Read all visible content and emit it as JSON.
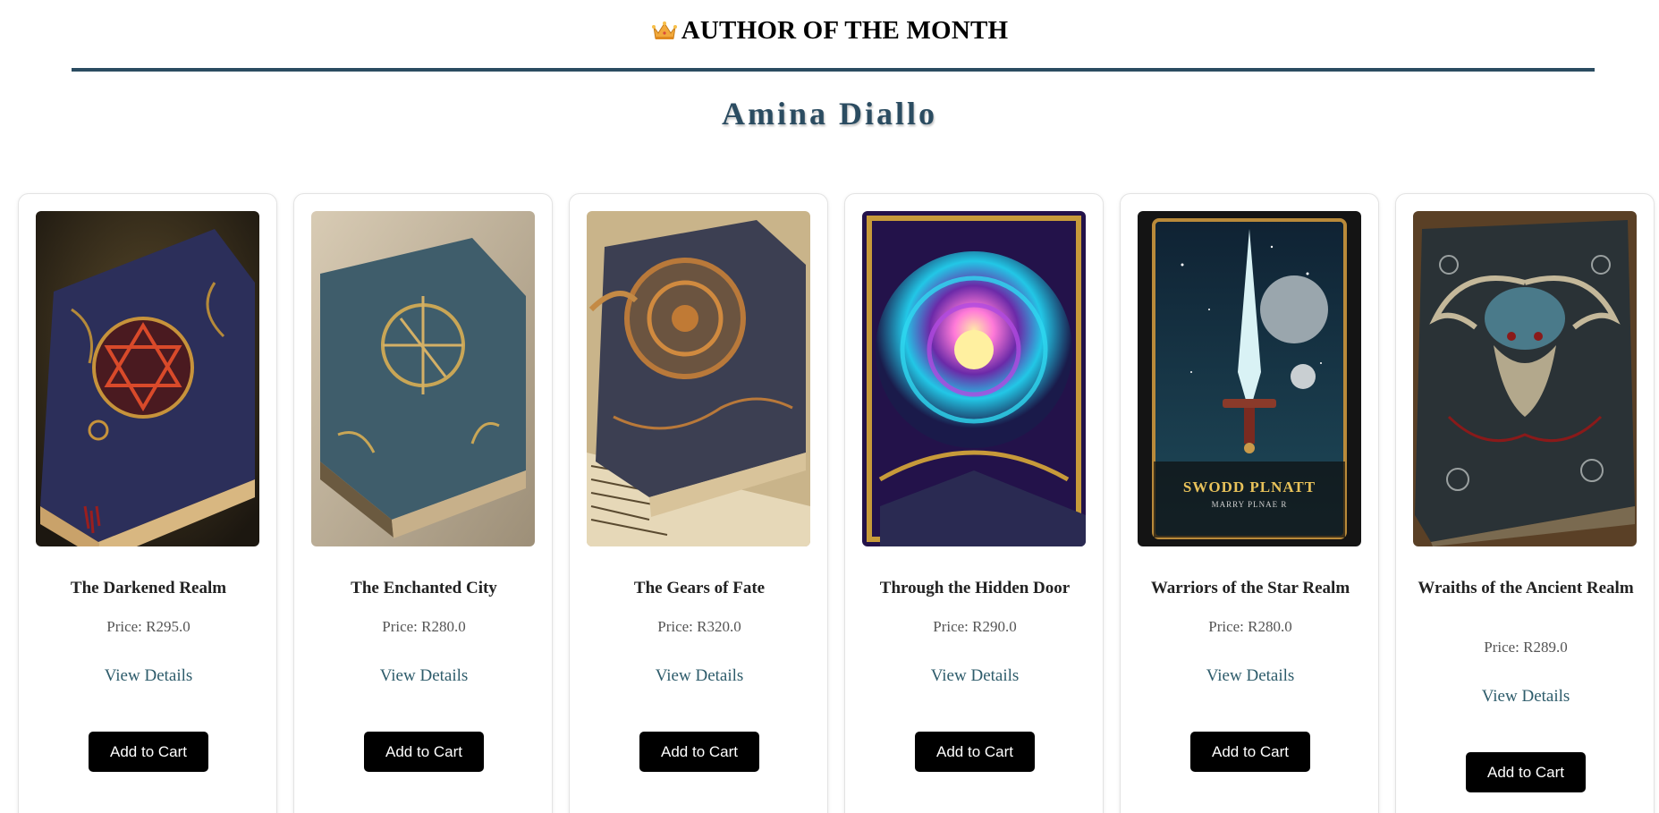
{
  "header": {
    "title": "AUTHOR OF THE MONTH",
    "icon": "crown-icon"
  },
  "author": {
    "name": "Amina Diallo"
  },
  "colors": {
    "accent": "#2b4c61",
    "link": "#2e5c6b",
    "button_bg": "#000000",
    "button_text": "#ffffff"
  },
  "books": [
    {
      "title": "The Darkened Realm",
      "price": "Price: R295.0",
      "details_label": "View Details",
      "cart_label": "Add to Cart"
    },
    {
      "title": "The Enchanted City",
      "price": "Price: R280.0",
      "details_label": "View Details",
      "cart_label": "Add to Cart"
    },
    {
      "title": "The Gears of Fate",
      "price": "Price: R320.0",
      "details_label": "View Details",
      "cart_label": "Add to Cart"
    },
    {
      "title": "Through the Hidden Door",
      "price": "Price: R290.0",
      "details_label": "View Details",
      "cart_label": "Add to Cart"
    },
    {
      "title": "Warriors of the Star Realm",
      "price": "Price: R280.0",
      "details_label": "View Details",
      "cart_label": "Add to Cart",
      "cover_text": "SWODD PLNATT",
      "cover_subtext": "MARRY PLNAE R"
    },
    {
      "title": "Wraiths of the Ancient Realm",
      "price": "Price: R289.0",
      "details_label": "View Details",
      "cart_label": "Add to Cart"
    }
  ]
}
